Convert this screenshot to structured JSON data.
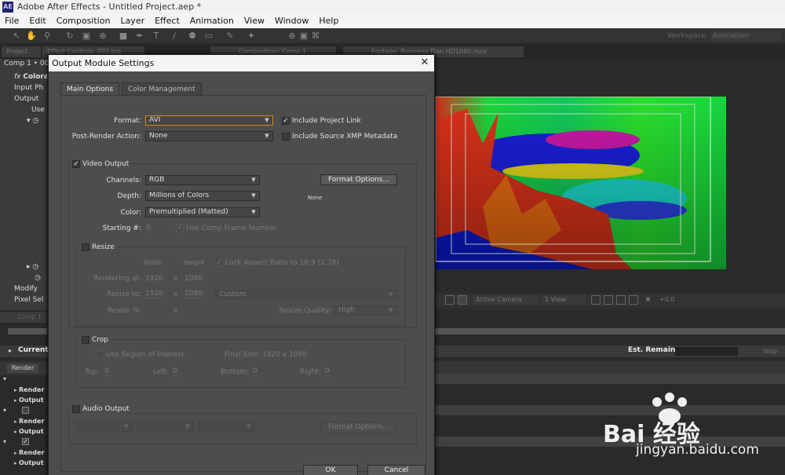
{
  "app": {
    "window_title": "Adobe After Effects - Untitled Project.aep *",
    "logo": "AE",
    "menus": [
      "File",
      "Edit",
      "Composition",
      "Layer",
      "Effect",
      "Animation",
      "View",
      "Window",
      "Help"
    ],
    "workspace_label": "Workspace:",
    "workspace_value": "Animation"
  },
  "panels": {
    "tabs": [
      "Project",
      "Effect Controls: 002.jpg",
      "Composition: Comp 1",
      "Footage: Business Plan HD1080.mov"
    ],
    "comp_label": "Comp 1 • 002",
    "left_rows": [
      "Colora",
      "Input Ph",
      "Output",
      "Use",
      "",
      "",
      "",
      "",
      "",
      "",
      "",
      "",
      "",
      "",
      "",
      "",
      "",
      "Modify",
      "Pixel Sel"
    ],
    "viewer_toolbar": {
      "camera": "Active Camera",
      "view": "1 View",
      "exposure": "+0.0"
    },
    "timeline_tab": "Comp 1",
    "current_label": "Current",
    "est_remain_label": "Est. Remain:",
    "stop_label": "Stop",
    "render_label": "Render",
    "queue_rows": [
      "Render",
      "Output",
      "Render",
      "Output",
      "Render",
      "Output"
    ]
  },
  "dialog": {
    "title": "Output Module Settings",
    "tabs": [
      "Main Options",
      "Color Management"
    ],
    "format_label": "Format:",
    "format_value": "AVI",
    "post_render_label": "Post-Render Action:",
    "post_render_value": "None",
    "include_project_link": "Include Project Link",
    "include_xmp": "Include Source XMP Metadata",
    "video_output": "Video Output",
    "channels_label": "Channels:",
    "channels_value": "RGB",
    "depth_label": "Depth:",
    "depth_value": "Millions of Colors",
    "color_label": "Color:",
    "color_value": "Premultiplied (Matted)",
    "starting_label": "Starting #:",
    "starting_value": "0",
    "use_comp_frame": "Use Comp Frame Number",
    "format_options": "Format Options...",
    "codec_info": "None",
    "resize": "Resize",
    "width_label": "Width",
    "height_label": "Height",
    "lock_aspect": "Lock Aspect Ratio to 16:9 (1.78)",
    "rendering_at_label": "Rendering at:",
    "rendering_w": "1920",
    "rendering_h": "1080",
    "resize_to_label": "Resize to:",
    "resize_w": "1920",
    "resize_h": "1080",
    "resize_preset": "Custom",
    "resize_pct_label": "Resize %:",
    "x": "x",
    "resize_quality_label": "Resize Quality:",
    "resize_quality": "High",
    "crop": "Crop",
    "use_roi": "Use Region of Interest",
    "final_size": "Final Size: 1920 x 1080",
    "top_label": "Top:",
    "left_label": "Left:",
    "bottom_label": "Bottom:",
    "right_label": "Right:",
    "top_val": "0",
    "left_val": "0",
    "bottom_val": "0",
    "right_val": "0",
    "audio_output": "Audio Output",
    "audio_format_options": "Format Options...",
    "ok": "OK",
    "cancel": "Cancel"
  },
  "watermark": {
    "brand": "Bai 经验",
    "url": "jingyan.baidu.com"
  }
}
